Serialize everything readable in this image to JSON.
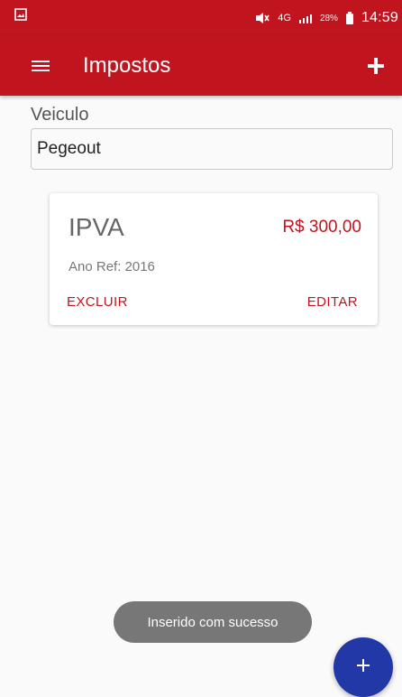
{
  "status_bar": {
    "battery_percent": "28%",
    "time": "14:59",
    "network_label": "4G",
    "notification_icon": "image-icon",
    "mute_icon": "mute-icon",
    "signal_icon": "signal-icon",
    "battery_icon": "battery-icon"
  },
  "app_bar": {
    "title": "Impostos",
    "menu_icon": "menu-icon",
    "add_icon": "plus-icon"
  },
  "vehicle": {
    "label": "Veiculo",
    "selected_value": "Pegeout"
  },
  "tax_card": {
    "name": "IPVA",
    "amount": "R$ 300,00",
    "reference_year": "Ano Ref: 2016",
    "delete_label": "EXCLUIR",
    "edit_label": "EDITAR"
  },
  "toast": {
    "message": "Inserido com sucesso"
  },
  "fab": {
    "icon": "plus-icon"
  },
  "colors": {
    "primary": "#c0151f",
    "fab": "#2138a6",
    "background": "#fafafa",
    "toast": "#777777"
  }
}
